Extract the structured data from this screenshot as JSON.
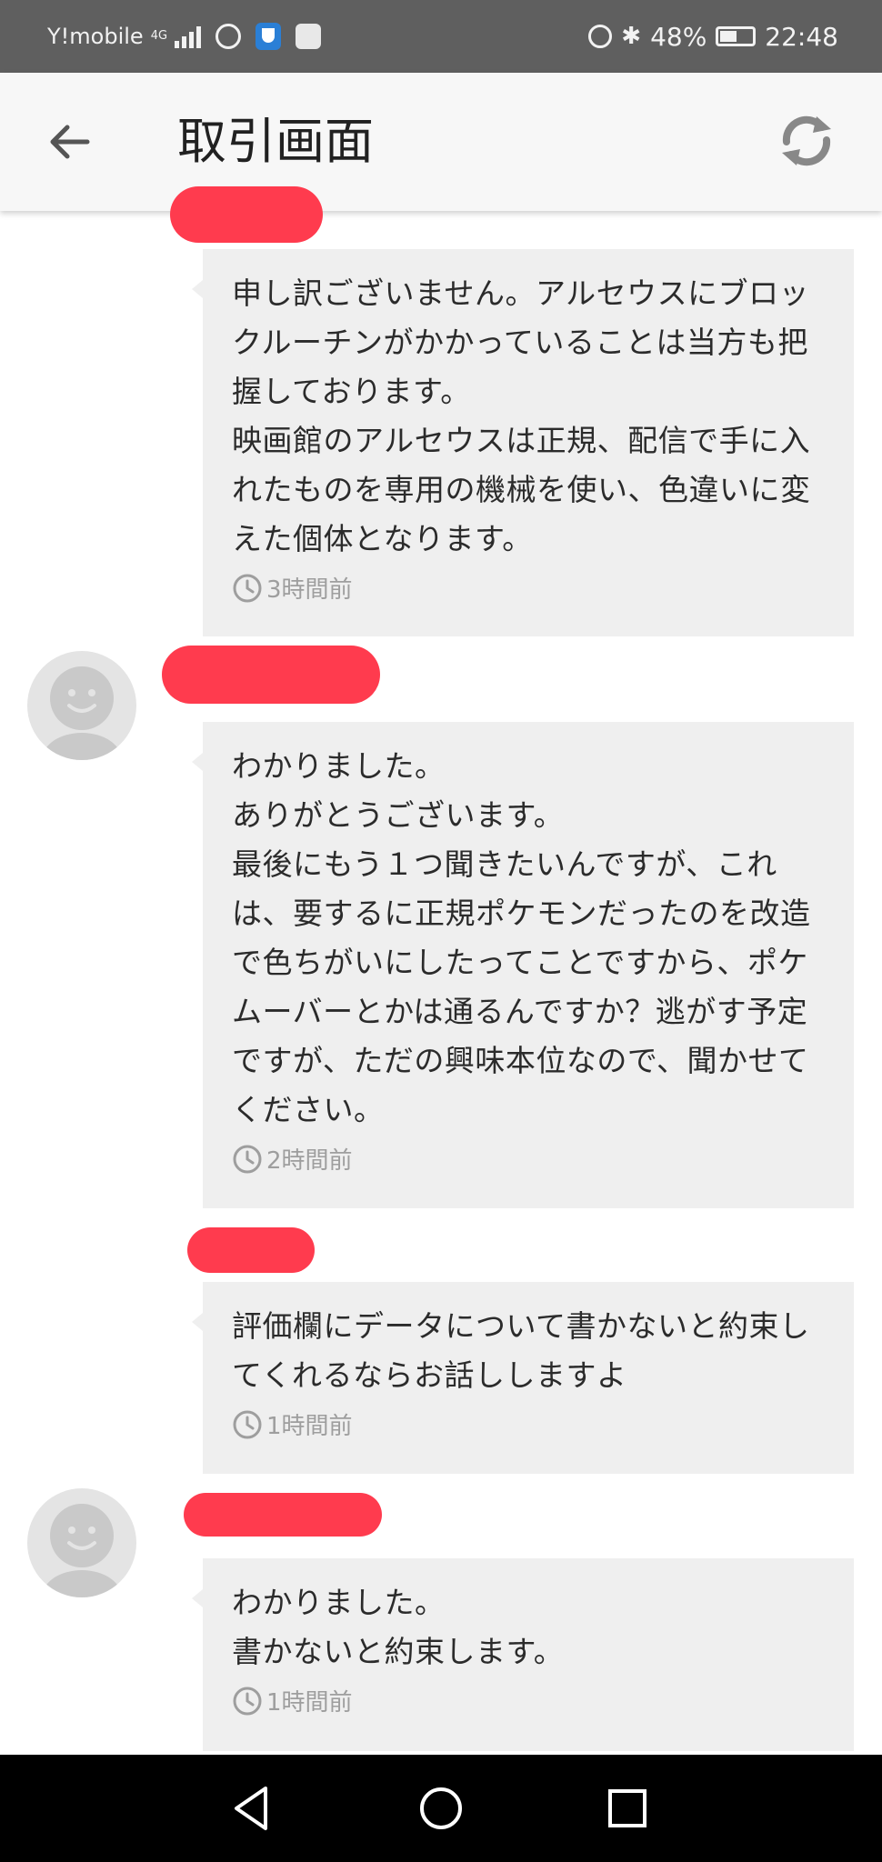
{
  "status_bar": {
    "carrier": "Y!mobile",
    "network": "4G",
    "battery": "48%",
    "battery_level": 0.48,
    "time": "22:48",
    "icons": [
      "signal-icon",
      "app-icon",
      "shield-icon",
      "cube-icon",
      "alarm-icon",
      "bluetooth-icon",
      "battery-icon"
    ]
  },
  "header": {
    "title": "取引画面",
    "back_icon": "arrow-left-icon",
    "refresh_icon": "refresh-icon"
  },
  "messages": [
    {
      "text": "申し訳ございません。アルセウスにブロックルーチンがかかっていることは当方も把握しております。\n映画館のアルセウスは正規、配信で手に入れたものを専用の機械を使い、色違いに変えた個体となります。",
      "time": "3時間前"
    },
    {
      "text": "わかりました。\nありがとうございます。\n最後にもう１つ聞きたいんですが、これは、要するに正規ポケモンだったのを改造で色ちがいにしたってことですから、ポケムーバーとかは通るんですか？逃がす予定ですが、ただの興味本位なので、聞かせてください。",
      "time": "2時間前"
    },
    {
      "text": "評価欄にデータについて書かないと約束してくれるならお話ししますよ",
      "time": "1時間前"
    },
    {
      "text": "わかりました。\n書かないと約束します。",
      "time": "1時間前"
    }
  ],
  "colors": {
    "status_bar": "#5f5f5f",
    "header": "#f7f7f7",
    "bubble": "#efefef",
    "redaction": "#ff3b4e",
    "nav_bar": "#000000"
  },
  "nav": {
    "icons": [
      "back-triangle-icon",
      "home-circle-icon",
      "recents-square-icon"
    ]
  }
}
